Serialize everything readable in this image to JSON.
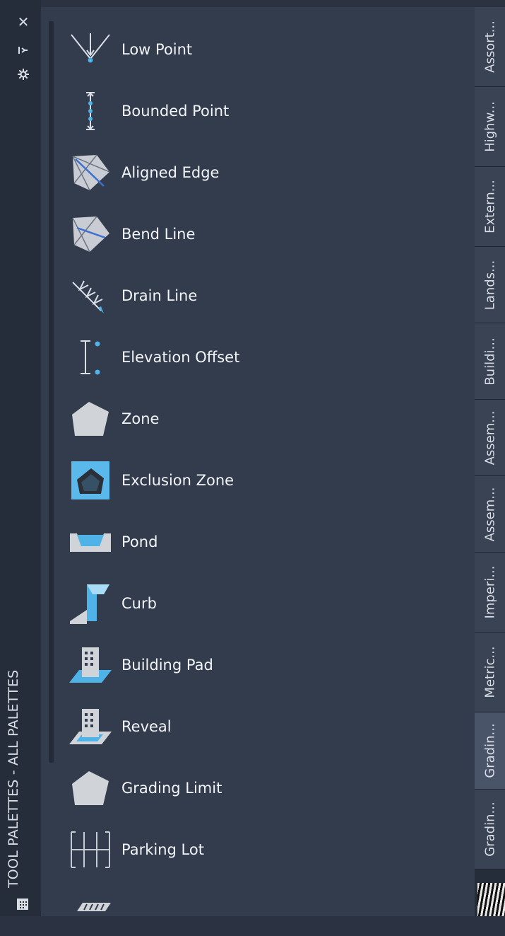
{
  "title_bar": {
    "title": "TOOL PALETTES - ALL PALETTES",
    "icons": [
      "close-icon",
      "auto-hide-icon",
      "properties-icon",
      "palette-menu-icon"
    ]
  },
  "tools": [
    {
      "label": "Low Point",
      "icon": "low-point-icon"
    },
    {
      "label": "Bounded Point",
      "icon": "bounded-point-icon"
    },
    {
      "label": "Aligned Edge",
      "icon": "aligned-edge-icon"
    },
    {
      "label": "Bend Line",
      "icon": "bend-line-icon"
    },
    {
      "label": "Drain Line",
      "icon": "drain-line-icon"
    },
    {
      "label": "Elevation Offset",
      "icon": "elevation-offset-icon"
    },
    {
      "label": "Zone",
      "icon": "zone-icon"
    },
    {
      "label": "Exclusion Zone",
      "icon": "exclusion-zone-icon"
    },
    {
      "label": "Pond",
      "icon": "pond-icon"
    },
    {
      "label": "Curb",
      "icon": "curb-icon"
    },
    {
      "label": "Building Pad",
      "icon": "building-pad-icon"
    },
    {
      "label": "Reveal",
      "icon": "reveal-icon"
    },
    {
      "label": "Grading Limit",
      "icon": "grading-limit-icon"
    },
    {
      "label": "Parking Lot",
      "icon": "parking-lot-icon"
    }
  ],
  "tabs": [
    {
      "label": "Assort..."
    },
    {
      "label": "Highw..."
    },
    {
      "label": "Extern..."
    },
    {
      "label": "Lands..."
    },
    {
      "label": "Buildi..."
    },
    {
      "label": "Assem..."
    },
    {
      "label": "Assem..."
    },
    {
      "label": "Imperi..."
    },
    {
      "label": "Metric..."
    },
    {
      "label": "Gradin...",
      "active": true
    },
    {
      "label": "Gradin..."
    }
  ],
  "colors": {
    "background": "#333c4d",
    "titlebar": "#262d3a",
    "accent": "#4fb3e8",
    "text": "#f2f4f7"
  }
}
